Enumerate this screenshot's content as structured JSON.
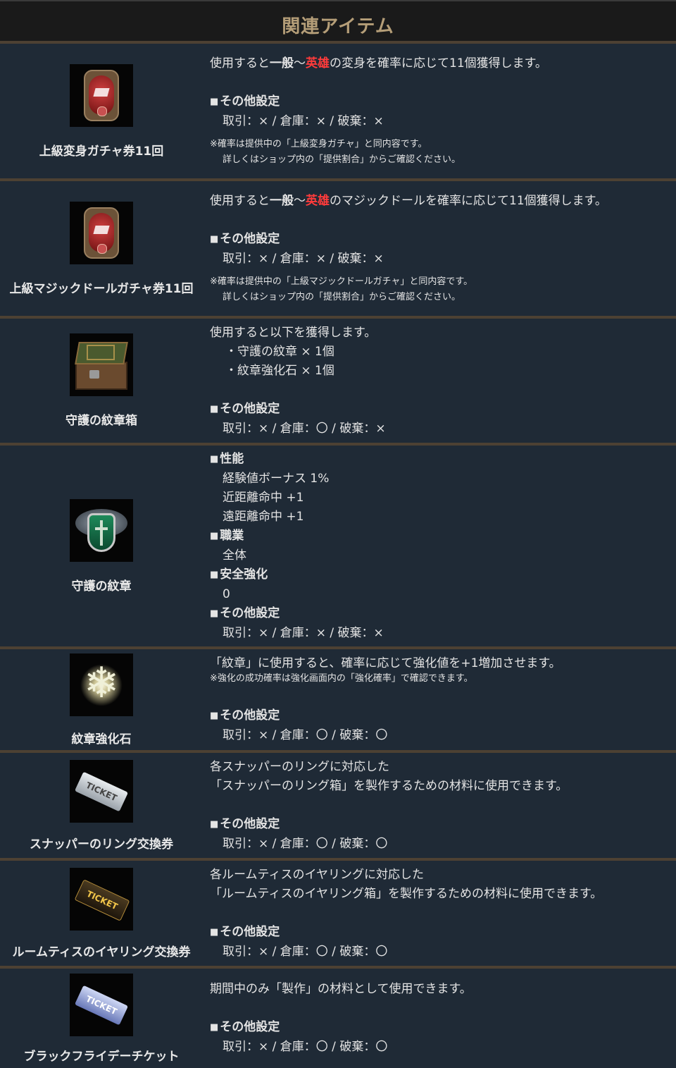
{
  "header": {
    "title": "関連アイテム"
  },
  "items": [
    {
      "name": "上級変身ガチャ券11回",
      "icon": "red-card-icon",
      "desc_pre": "使用すると",
      "desc_b1": "一般",
      "desc_sep": "～",
      "desc_red": "英雄",
      "desc_post": "の変身を確率に応じて11個獲得します。",
      "other_label": "その他設定",
      "other_value": "取引：× / 倉庫：× / 破棄：×",
      "note1": "※確率は提供中の「上級変身ガチャ」と同内容です。",
      "note2": "詳しくはショップ内の「提供割合」からご確認ください。"
    },
    {
      "name": "上級マジックドールガチャ券11回",
      "icon": "red-card-icon",
      "desc_pre": "使用すると",
      "desc_b1": "一般",
      "desc_sep": "～",
      "desc_red": "英雄",
      "desc_post": "のマジックドールを確率に応じて11個獲得します。",
      "other_label": "その他設定",
      "other_value": "取引：× / 倉庫：× / 破棄：×",
      "note1": "※確率は提供中の「上級マジックドールガチャ」と同内容です。",
      "note2": "詳しくはショップ内の「提供割合」からご確認ください。"
    },
    {
      "name": "守護の紋章箱",
      "icon": "treasure-chest-icon",
      "desc": "使用すると以下を獲得します。",
      "list": [
        "・守護の紋章 × 1個",
        "・紋章強化石 × 1個"
      ],
      "other_label": "その他設定",
      "other_value": "取引：× / 倉庫：〇 / 破棄：×"
    },
    {
      "name": "守護の紋章",
      "icon": "shield-emblem-icon",
      "perf_label": "性能",
      "perf": [
        "経験値ボーナス 1%",
        "近距離命中 +1",
        "遠距離命中 +1"
      ],
      "class_label": "職業",
      "class_value": "全体",
      "safe_label": "安全強化",
      "safe_value": "0",
      "other_label": "その他設定",
      "other_value": "取引：× / 倉庫：× / 破棄：×"
    },
    {
      "name": "紋章強化石",
      "icon": "snowflake-crystal-icon",
      "desc": "「紋章」に使用すると、確率に応じて強化値を+1増加させます。",
      "note": "※強化の成功確率は強化画面内の「強化確率」で確認できます。",
      "other_label": "その他設定",
      "other_value": "取引：× / 倉庫：〇 / 破棄：〇"
    },
    {
      "name": "スナッパーのリング交換券",
      "icon": "silver-ticket-icon",
      "icon_text": "TICKET",
      "desc1": "各スナッパーのリングに対応した",
      "desc2": "「スナッパーのリング箱」を製作するための材料に使用できます。",
      "other_label": "その他設定",
      "other_value": "取引：× / 倉庫：〇 / 破棄：〇"
    },
    {
      "name": "ルームティスのイヤリング交換券",
      "icon": "gold-ticket-icon",
      "icon_text": "TICKET",
      "desc1": "各ルームティスのイヤリングに対応した",
      "desc2": "「ルームティスのイヤリング箱」を製作するための材料に使用できます。",
      "other_label": "その他設定",
      "other_value": "取引：× / 倉庫：〇 / 破棄：〇"
    },
    {
      "name": "ブラックフライデーチケット",
      "icon": "blue-ticket-icon",
      "icon_text": "TICKET",
      "desc": "期間中のみ「製作」の材料として使用できます。",
      "other_label": "その他設定",
      "other_value": "取引：× / 倉庫：〇 / 破棄：〇"
    }
  ]
}
